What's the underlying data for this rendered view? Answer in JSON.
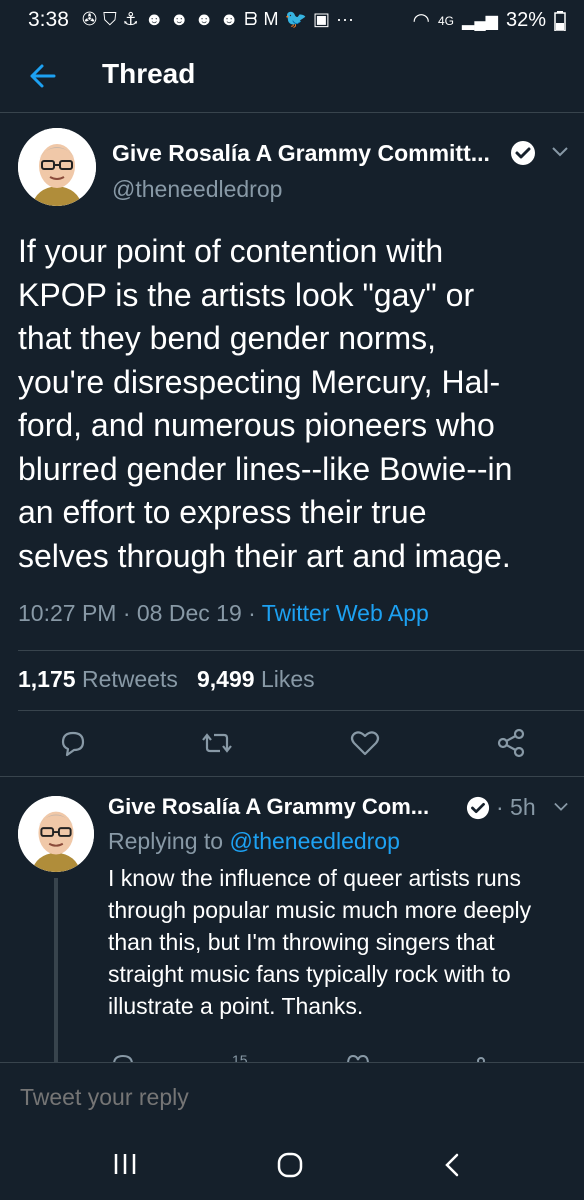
{
  "status_bar": {
    "time": "3:38",
    "network": "4G",
    "battery": "32%"
  },
  "header": {
    "title": "Thread"
  },
  "tweet": {
    "author_name": "Give Rosalía A Grammy Committ...",
    "handle": "@theneedledrop",
    "lines": [
      "If your point of contention with",
      "KPOP is the artists look \"gay\" or",
      "that they bend gender norms,",
      "you're disrespecting Mercury, Hal-",
      "ford, and numerous pioneers who",
      "blurred gender lines--like Bowie--in",
      "an effort to express their true",
      "selves through their art and image."
    ],
    "time": "10:27 PM · 08 Dec 19 · ",
    "source": "Twitter Web App",
    "retweets_count": "1,175",
    "retweets_label": "Retweets",
    "likes_count": "9,499",
    "likes_label": "Likes"
  },
  "reply": {
    "author_name": "Give Rosalía A Grammy Com...",
    "age": "· 5h",
    "replying_prefix": "Replying to ",
    "replying_to": "@theneedledrop",
    "lines": [
      "I know the influence of queer artists runs",
      "through popular music much more deeply",
      "than this, but I'm throwing singers that",
      "straight music fans typically rock with to",
      "illustrate a point. Thanks."
    ],
    "partial_stat": "15"
  },
  "compose": {
    "placeholder": "Tweet your reply"
  },
  "colors": {
    "background": "#15202b",
    "accent": "#1da1f2",
    "muted": "#8899a6",
    "divider": "#38444d"
  }
}
